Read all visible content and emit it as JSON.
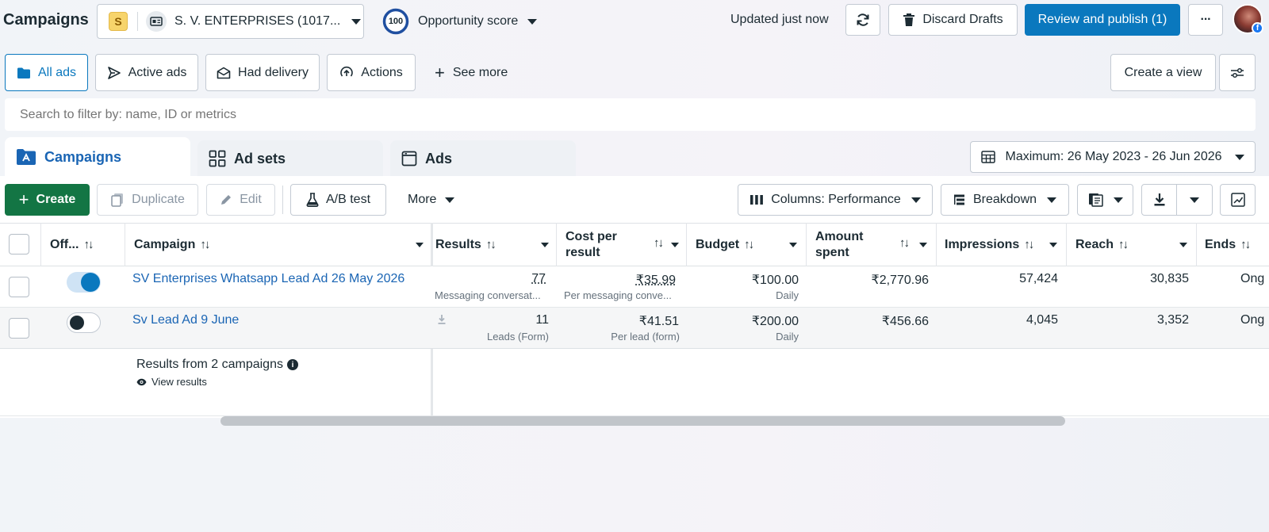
{
  "header": {
    "title": "Campaigns",
    "account_badge": "S",
    "account_name": "S. V. ENTERPRISES (1017...",
    "score": "100",
    "score_label": "Opportunity score",
    "updated": "Updated just now",
    "discard_label": "Discard Drafts",
    "review_label": "Review and publish (1)",
    "more_label": "···"
  },
  "views": {
    "items": [
      "All ads",
      "Active ads",
      "Had delivery",
      "Actions",
      "See more"
    ],
    "create_view": "Create a view"
  },
  "search": {
    "placeholder": "Search to filter by: name, ID or metrics"
  },
  "tabs": [
    "Campaigns",
    "Ad sets",
    "Ads"
  ],
  "date_range": "Maximum: 26 May 2023 - 26 Jun 2026",
  "toolbar": {
    "create": "Create",
    "duplicate": "Duplicate",
    "edit": "Edit",
    "ab_test": "A/B test",
    "more": "More",
    "columns": "Columns: Performance",
    "breakdown": "Breakdown"
  },
  "columns": {
    "off": "Off...",
    "campaign": "Campaign",
    "results": "Results",
    "cost_per_result": "Cost per result",
    "budget": "Budget",
    "amount_spent": "Amount spent",
    "impressions": "Impressions",
    "reach": "Reach",
    "ends": "Ends"
  },
  "rows": [
    {
      "name": "SV Enterprises Whatsapp Lead Ad 26 May 2026",
      "on": true,
      "results": "77",
      "results_sub": "Messaging conversat...",
      "cost": "₹35.99",
      "cost_sub": "Per messaging conve...",
      "budget": "₹100.00",
      "budget_sub": "Daily",
      "spent": "₹2,770.96",
      "impressions": "57,424",
      "reach": "30,835",
      "ends": "Ong"
    },
    {
      "name": "Sv Lead Ad 9 June",
      "on": false,
      "results": "11",
      "results_sub": "Leads (Form)",
      "cost": "₹41.51",
      "cost_sub": "Per lead (form)",
      "budget": "₹200.00",
      "budget_sub": "Daily",
      "spent": "₹456.66",
      "impressions": "4,045",
      "reach": "3,352",
      "ends": "Ong"
    }
  ],
  "summary": {
    "label": "Results from 2 campaigns",
    "view": "View results"
  },
  "colors": {
    "accent": "#0a78be",
    "green": "#137544",
    "link": "#1a65b4"
  }
}
